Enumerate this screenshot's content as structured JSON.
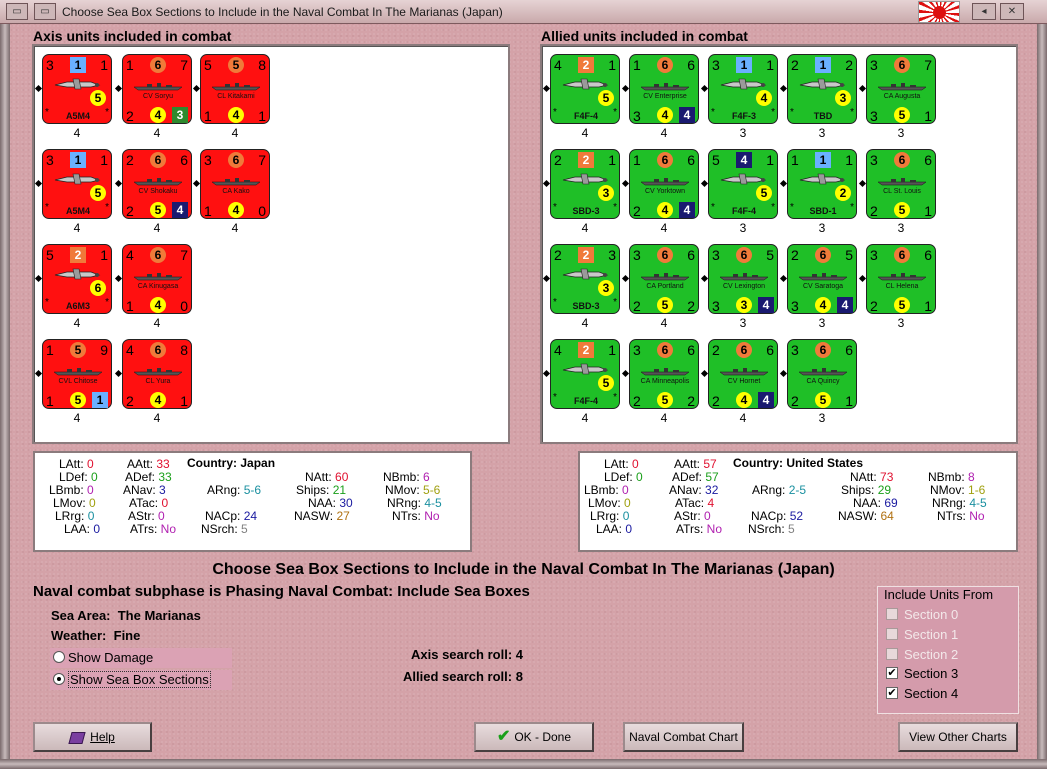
{
  "window": {
    "title": "Choose Sea Box Sections to Include in the Naval Combat In The Marianas (Japan)"
  },
  "axis_header": "Axis units included in combat",
  "allied_header": "Allied units included in combat",
  "axis_units": [
    {
      "name": "A5M4",
      "kind": "air",
      "color": "red",
      "tl": "3",
      "tr": "1",
      "blue": "1",
      "yb": "5",
      "below": "4"
    },
    {
      "name": "CV Soryu",
      "kind": "ship",
      "color": "red",
      "tl": "1",
      "tr": "7",
      "orange": "6",
      "bl": "2",
      "yb": "4",
      "green_sq": "3",
      "below": "4"
    },
    {
      "name": "CL Kitakami",
      "kind": "ship",
      "color": "red",
      "tl": "5",
      "tr": "8",
      "orange": "5",
      "bl": "1",
      "yb": "4",
      "br": "1",
      "below": "4"
    },
    {
      "name": "A5M4",
      "kind": "air",
      "color": "red",
      "tl": "3",
      "tr": "1",
      "blue": "1",
      "yb": "5",
      "below": "4"
    },
    {
      "name": "CV Shokaku",
      "kind": "ship",
      "color": "red",
      "tl": "2",
      "tr": "6",
      "orange": "6",
      "bl": "2",
      "yb": "5",
      "navy_sq": "4",
      "below": "4"
    },
    {
      "name": "CA Kako",
      "kind": "ship",
      "color": "red",
      "tl": "3",
      "tr": "7",
      "orange": "6",
      "bl": "1",
      "yb": "4",
      "br": "0",
      "below": "4"
    },
    {
      "name": "A6M3",
      "kind": "air",
      "color": "red",
      "tl": "5",
      "tr": "1",
      "orange_sq": "2",
      "yb": "6",
      "below": "4"
    },
    {
      "name": "CA Kinugasa",
      "kind": "ship",
      "color": "red",
      "tl": "4",
      "tr": "7",
      "orange": "6",
      "bl": "1",
      "yb": "4",
      "br": "0",
      "below": "4"
    },
    {
      "name": "CVL Chitose",
      "kind": "ship",
      "color": "red",
      "tl": "1",
      "tr": "9",
      "orange": "5",
      "bl": "1",
      "yb": "5",
      "blue_sq": "1",
      "below": "4"
    },
    {
      "name": "CL Yura",
      "kind": "ship",
      "color": "red",
      "tl": "4",
      "tr": "8",
      "orange": "6",
      "bl": "2",
      "yb": "4",
      "br": "1",
      "below": "4"
    }
  ],
  "allied_units": [
    {
      "name": "F4F-4",
      "kind": "air",
      "color": "green",
      "tl": "4",
      "tr": "1",
      "orange_sq": "2",
      "yb": "5",
      "below": "4"
    },
    {
      "name": "CV Enterprise",
      "kind": "ship",
      "color": "green",
      "tl": "1",
      "tr": "6",
      "orange": "6",
      "bl": "3",
      "yb": "4",
      "navy_sq": "4",
      "below": "4"
    },
    {
      "name": "F4F-3",
      "kind": "air",
      "color": "green",
      "tl": "3",
      "tr": "1",
      "blue": "1",
      "yb": "4",
      "below": "3"
    },
    {
      "name": "TBD",
      "kind": "air",
      "color": "green",
      "tl": "2",
      "tr": "2",
      "blue": "1",
      "yb": "3",
      "below": "3"
    },
    {
      "name": "CA Augusta",
      "kind": "ship",
      "color": "green",
      "tl": "3",
      "tr": "7",
      "orange": "6",
      "bl": "3",
      "yb": "5",
      "br": "1",
      "below": "3"
    },
    {
      "name": "SBD-3",
      "kind": "air",
      "color": "green",
      "tl": "2",
      "tr": "1",
      "orange_sq": "2",
      "yb": "3",
      "below": "4"
    },
    {
      "name": "CV Yorktown",
      "kind": "ship",
      "color": "green",
      "tl": "1",
      "tr": "6",
      "orange": "6",
      "bl": "2",
      "yb": "4",
      "navy_sq": "4",
      "below": "4"
    },
    {
      "name": "F4F-4",
      "kind": "air",
      "color": "green",
      "tl": "5",
      "tr": "1",
      "navy": "4",
      "yb": "5",
      "below": "3"
    },
    {
      "name": "SBD-1",
      "kind": "air",
      "color": "green",
      "tl": "1",
      "tr": "1",
      "blue": "1",
      "yb": "2",
      "below": "3"
    },
    {
      "name": "CL St. Louis",
      "kind": "ship",
      "color": "green",
      "tl": "3",
      "tr": "6",
      "orange": "6",
      "bl": "2",
      "yb": "5",
      "br": "1",
      "below": "3"
    },
    {
      "name": "SBD-3",
      "kind": "air",
      "color": "green",
      "tl": "2",
      "tr": "3",
      "orange_sq": "2",
      "yb": "3",
      "below": "4"
    },
    {
      "name": "CA Portland",
      "kind": "ship",
      "color": "green",
      "tl": "3",
      "tr": "6",
      "orange": "6",
      "bl": "2",
      "yb": "5",
      "br": "2",
      "below": "4"
    },
    {
      "name": "CV Lexington",
      "kind": "ship",
      "color": "green",
      "tl": "3",
      "tr": "5",
      "orange": "6",
      "bl": "3",
      "yb": "3",
      "navy_sq": "4",
      "below": "3"
    },
    {
      "name": "CV Saratoga",
      "kind": "ship",
      "color": "green",
      "tl": "2",
      "tr": "5",
      "orange": "6",
      "bl": "3",
      "yb": "4",
      "navy_sq": "4",
      "below": "3"
    },
    {
      "name": "CL Helena",
      "kind": "ship",
      "color": "green",
      "tl": "3",
      "tr": "6",
      "orange": "6",
      "bl": "2",
      "yb": "5",
      "br": "1",
      "below": "3"
    },
    {
      "name": "F4F-4",
      "kind": "air",
      "color": "green",
      "tl": "4",
      "tr": "1",
      "orange_sq": "2",
      "yb": "5",
      "below": "4"
    },
    {
      "name": "CA Minneapolis",
      "kind": "ship",
      "color": "green",
      "tl": "3",
      "tr": "6",
      "orange": "6",
      "bl": "2",
      "yb": "5",
      "br": "2",
      "below": "4"
    },
    {
      "name": "CV Hornet",
      "kind": "ship",
      "color": "green",
      "tl": "2",
      "tr": "6",
      "orange": "6",
      "bl": "2",
      "yb": "4",
      "navy_sq": "4",
      "below": "4"
    },
    {
      "name": "CA Quincy",
      "kind": "ship",
      "color": "green",
      "tl": "3",
      "tr": "6",
      "orange": "6",
      "bl": "2",
      "yb": "5",
      "br": "1",
      "below": "3"
    }
  ],
  "axis_stats": {
    "LAtt": "0",
    "LDef": "0",
    "LBmb": "0",
    "LMov": "0",
    "LRrg": "0",
    "LAA": "0",
    "AAtt": "33",
    "ADef": "33",
    "ANav": "3",
    "ATac": "0",
    "AStr": "0",
    "ATrs": "No",
    "ARng": "5-6",
    "NACp": "24",
    "NSrch": "5",
    "country_label": "Country:",
    "country": "Japan",
    "NAtt": "60",
    "Ships": "21",
    "NAA": "30",
    "NASW": "27",
    "NBmb": "6",
    "NMov": "5-6",
    "NRng": "4-5",
    "NTrs": "No"
  },
  "allied_stats": {
    "LAtt": "0",
    "LDef": "0",
    "LBmb": "0",
    "LMov": "0",
    "LRrg": "0",
    "LAA": "0",
    "AAtt": "57",
    "ADef": "57",
    "ANav": "32",
    "ATac": "4",
    "AStr": "0",
    "ATrs": "No",
    "ARng": "2-5",
    "NACp": "52",
    "NSrch": "5",
    "country_label": "Country:",
    "country": "United States",
    "NAtt": "73",
    "Ships": "29",
    "NAA": "69",
    "NASW": "64",
    "NBmb": "8",
    "NMov": "1-6",
    "NRng": "4-5",
    "NTrs": "No"
  },
  "main_heading": "Choose Sea Box Sections to Include in the Naval Combat In The Marianas (Japan)",
  "subphase_text": "Naval combat subphase is Phasing Naval Combat: Include Sea Boxes",
  "sea_area_label": "Sea Area:",
  "sea_area": "The Marianas",
  "weather_label": "Weather:",
  "weather": "Fine",
  "radio_options": [
    {
      "label": "Show Damage",
      "selected": false
    },
    {
      "label": "Show Sea Box Sections",
      "selected": true
    }
  ],
  "axis_search_label": "Axis search roll:",
  "axis_search": "4",
  "allied_search_label": "Allied search roll:",
  "allied_search": "8",
  "include_box": {
    "title": "Include Units From",
    "sections": [
      {
        "label": "Section 0",
        "checked": false,
        "enabled": false
      },
      {
        "label": "Section 1",
        "checked": false,
        "enabled": false
      },
      {
        "label": "Section 2",
        "checked": false,
        "enabled": false
      },
      {
        "label": "Section 3",
        "checked": true,
        "enabled": true
      },
      {
        "label": "Section 4",
        "checked": true,
        "enabled": true
      }
    ]
  },
  "buttons": {
    "help": "Help",
    "ok": "OK - Done",
    "chart": "Naval Combat Chart",
    "other": "View Other Charts"
  },
  "colors": {
    "axis_counter": "#ff1010",
    "allied_counter": "#1fbf27",
    "orange_badge": "#f07a3a",
    "yellow_badge": "#ffff00",
    "blue_badge": "#6ab0ff",
    "navy_badge": "#1a1a70"
  }
}
